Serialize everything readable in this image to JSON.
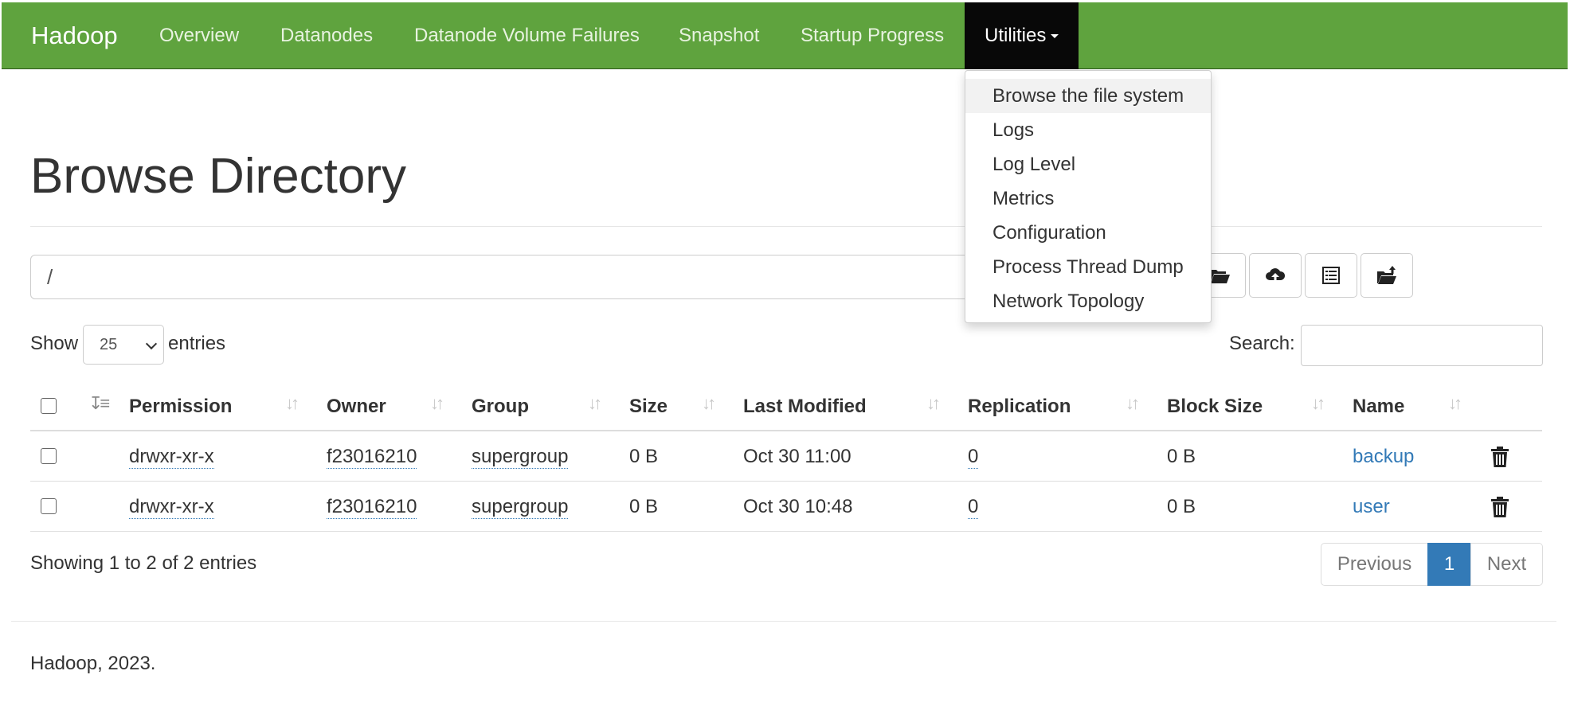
{
  "nav": {
    "brand": "Hadoop",
    "items": [
      "Overview",
      "Datanodes",
      "Datanode Volume Failures",
      "Snapshot",
      "Startup Progress"
    ],
    "active": "Utilities"
  },
  "dropdown": {
    "items": [
      "Browse the file system",
      "Logs",
      "Log Level",
      "Metrics",
      "Configuration",
      "Process Thread Dump",
      "Network Topology"
    ]
  },
  "page": {
    "title": "Browse Directory"
  },
  "path": {
    "value": "/"
  },
  "toolbar": {
    "icons": [
      "folder-open-icon",
      "cloud-upload-icon",
      "list-icon",
      "folder-upload-icon"
    ]
  },
  "controls": {
    "show_label": "Show",
    "entries_value": "25",
    "entries_label": "entries",
    "search_label": "Search:"
  },
  "table": {
    "headers": [
      "Permission",
      "Owner",
      "Group",
      "Size",
      "Last Modified",
      "Replication",
      "Block Size",
      "Name"
    ],
    "rows": [
      [
        "drwxr-xr-x",
        "f23016210",
        "supergroup",
        "0 B",
        "Oct 30 11:00",
        "0",
        "0 B",
        "backup"
      ],
      [
        "drwxr-xr-x",
        "f23016210",
        "supergroup",
        "0 B",
        "Oct 30 10:48",
        "0",
        "0 B",
        "user"
      ]
    ]
  },
  "info": {
    "showing": "Showing 1 to 2 of 2 entries"
  },
  "pagination": {
    "previous": "Previous",
    "current": "1",
    "next": "Next"
  },
  "footer": {
    "text": "Hadoop, 2023."
  },
  "colors": {
    "navbar": "#5fa33e",
    "nav_active": "#080808",
    "link": "#337ab7",
    "page_active": "#337ab7"
  }
}
